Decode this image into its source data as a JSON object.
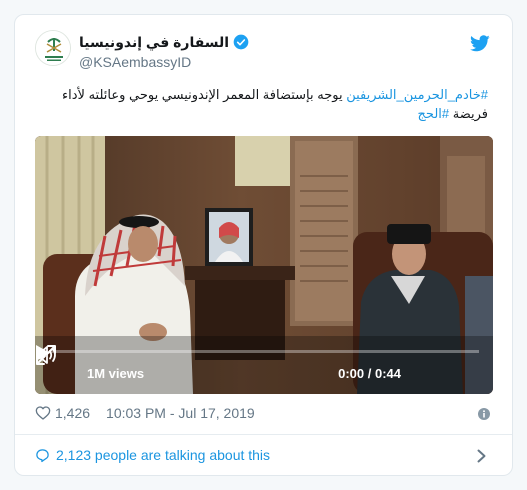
{
  "author": {
    "name": "السفارة في إندونيسيا",
    "handle": "@KSAembassyID"
  },
  "tweet": {
    "hashtag1": "#خادم_الحرمين_الشريفين",
    "body": " يوجه بإستضافة المعمر الإندونيسي يوحي وعائلته لأداء فريضة ",
    "hashtag2": "#الحج"
  },
  "video": {
    "views": "1M views",
    "time": "0:00 / 0:44",
    "progress": 0
  },
  "meta": {
    "likes": "1,426",
    "timestamp": "10:03 PM - Jul 17, 2019"
  },
  "footer": {
    "talking": "2,123 people are talking about this"
  },
  "colors": {
    "accent": "#1b95e0",
    "verified": "#1da1f2",
    "secondary_text": "#657786"
  }
}
